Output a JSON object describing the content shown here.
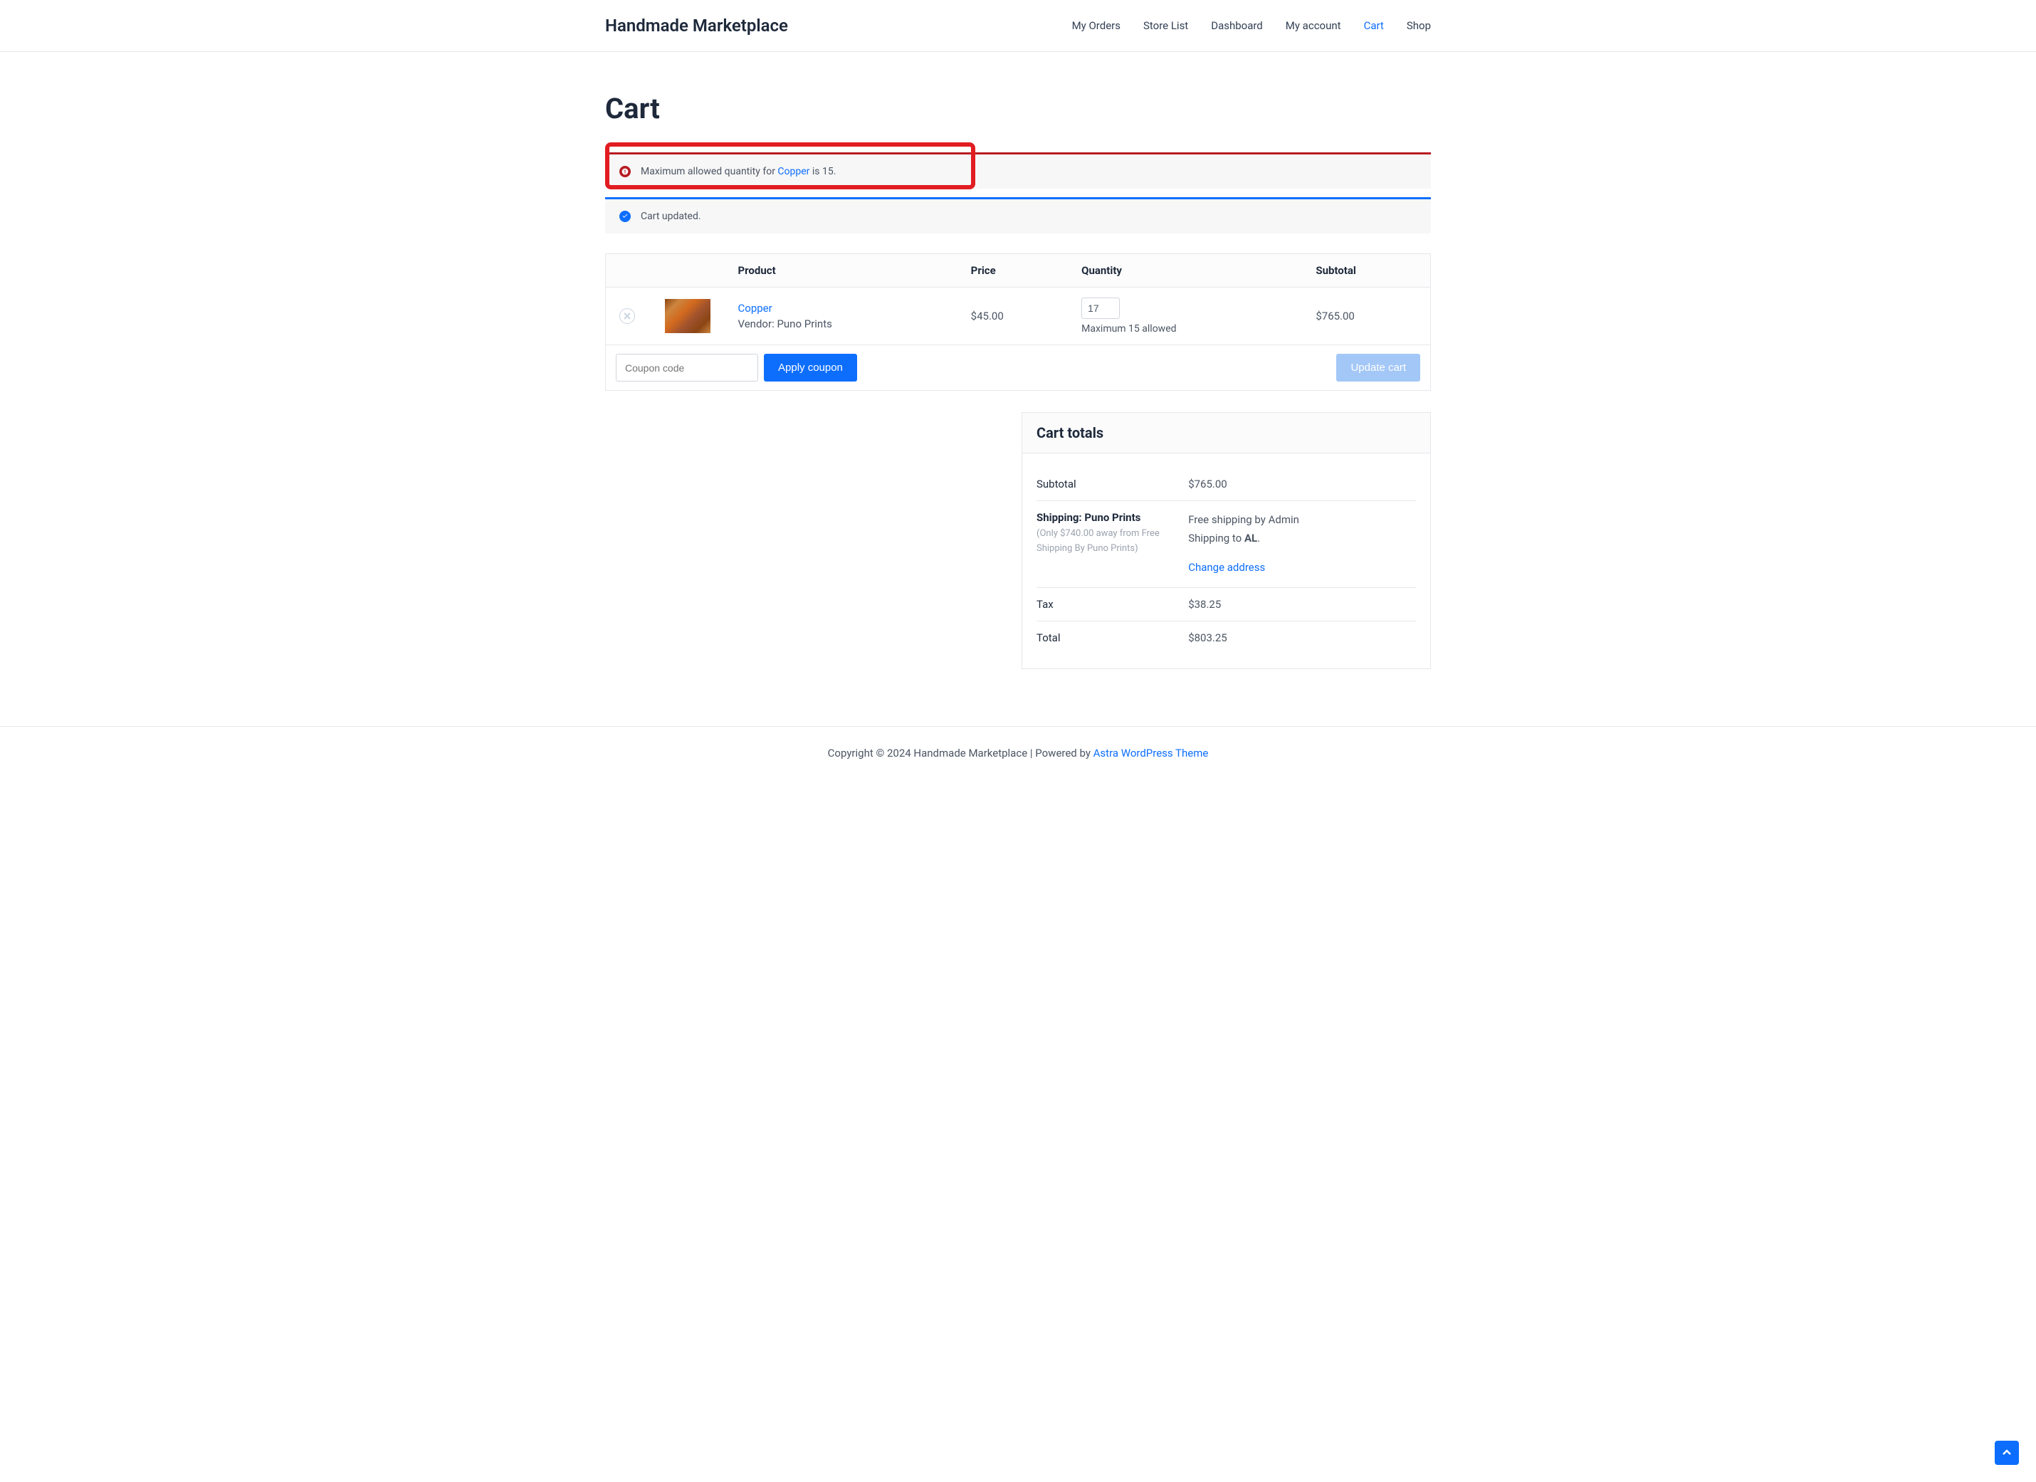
{
  "site": {
    "title": "Handmade Marketplace"
  },
  "nav": {
    "items": [
      {
        "label": "My Orders",
        "active": false
      },
      {
        "label": "Store List",
        "active": false
      },
      {
        "label": "Dashboard",
        "active": false
      },
      {
        "label": "My account",
        "active": false
      },
      {
        "label": "Cart",
        "active": true
      },
      {
        "label": "Shop",
        "active": false
      }
    ]
  },
  "page": {
    "title": "Cart"
  },
  "notices": {
    "error": {
      "before": "Maximum allowed quantity for ",
      "link": "Copper",
      "after": " is 15."
    },
    "info": "Cart updated."
  },
  "table": {
    "headers": {
      "product": "Product",
      "price": "Price",
      "quantity": "Quantity",
      "subtotal": "Subtotal"
    },
    "row": {
      "product_name": "Copper",
      "vendor_label": "Vendor:",
      "vendor_name": "Puno Prints",
      "price": "$45.00",
      "qty_value": "17",
      "qty_note": "Maximum 15 allowed",
      "subtotal": "$765.00"
    }
  },
  "actions": {
    "coupon_placeholder": "Coupon code",
    "apply_coupon": "Apply coupon",
    "update_cart": "Update cart"
  },
  "totals": {
    "title": "Cart totals",
    "subtotal_label": "Subtotal",
    "subtotal_value": "$765.00",
    "shipping_label": "Shipping: Puno Prints",
    "shipping_note_1": "(Only $740.00 away from Free Shipping By Puno Prints)",
    "shipping_text_1": "Free shipping by Admin",
    "shipping_text_2a": "Shipping to ",
    "shipping_text_2b": "AL",
    "shipping_text_2c": ".",
    "change_address": "Change address",
    "tax_label": "Tax",
    "tax_value": "$38.25",
    "total_label": "Total",
    "total_value": "$803.25"
  },
  "footer": {
    "text": "Copyright © 2024 Handmade Marketplace | Powered by ",
    "link": "Astra WordPress Theme"
  }
}
